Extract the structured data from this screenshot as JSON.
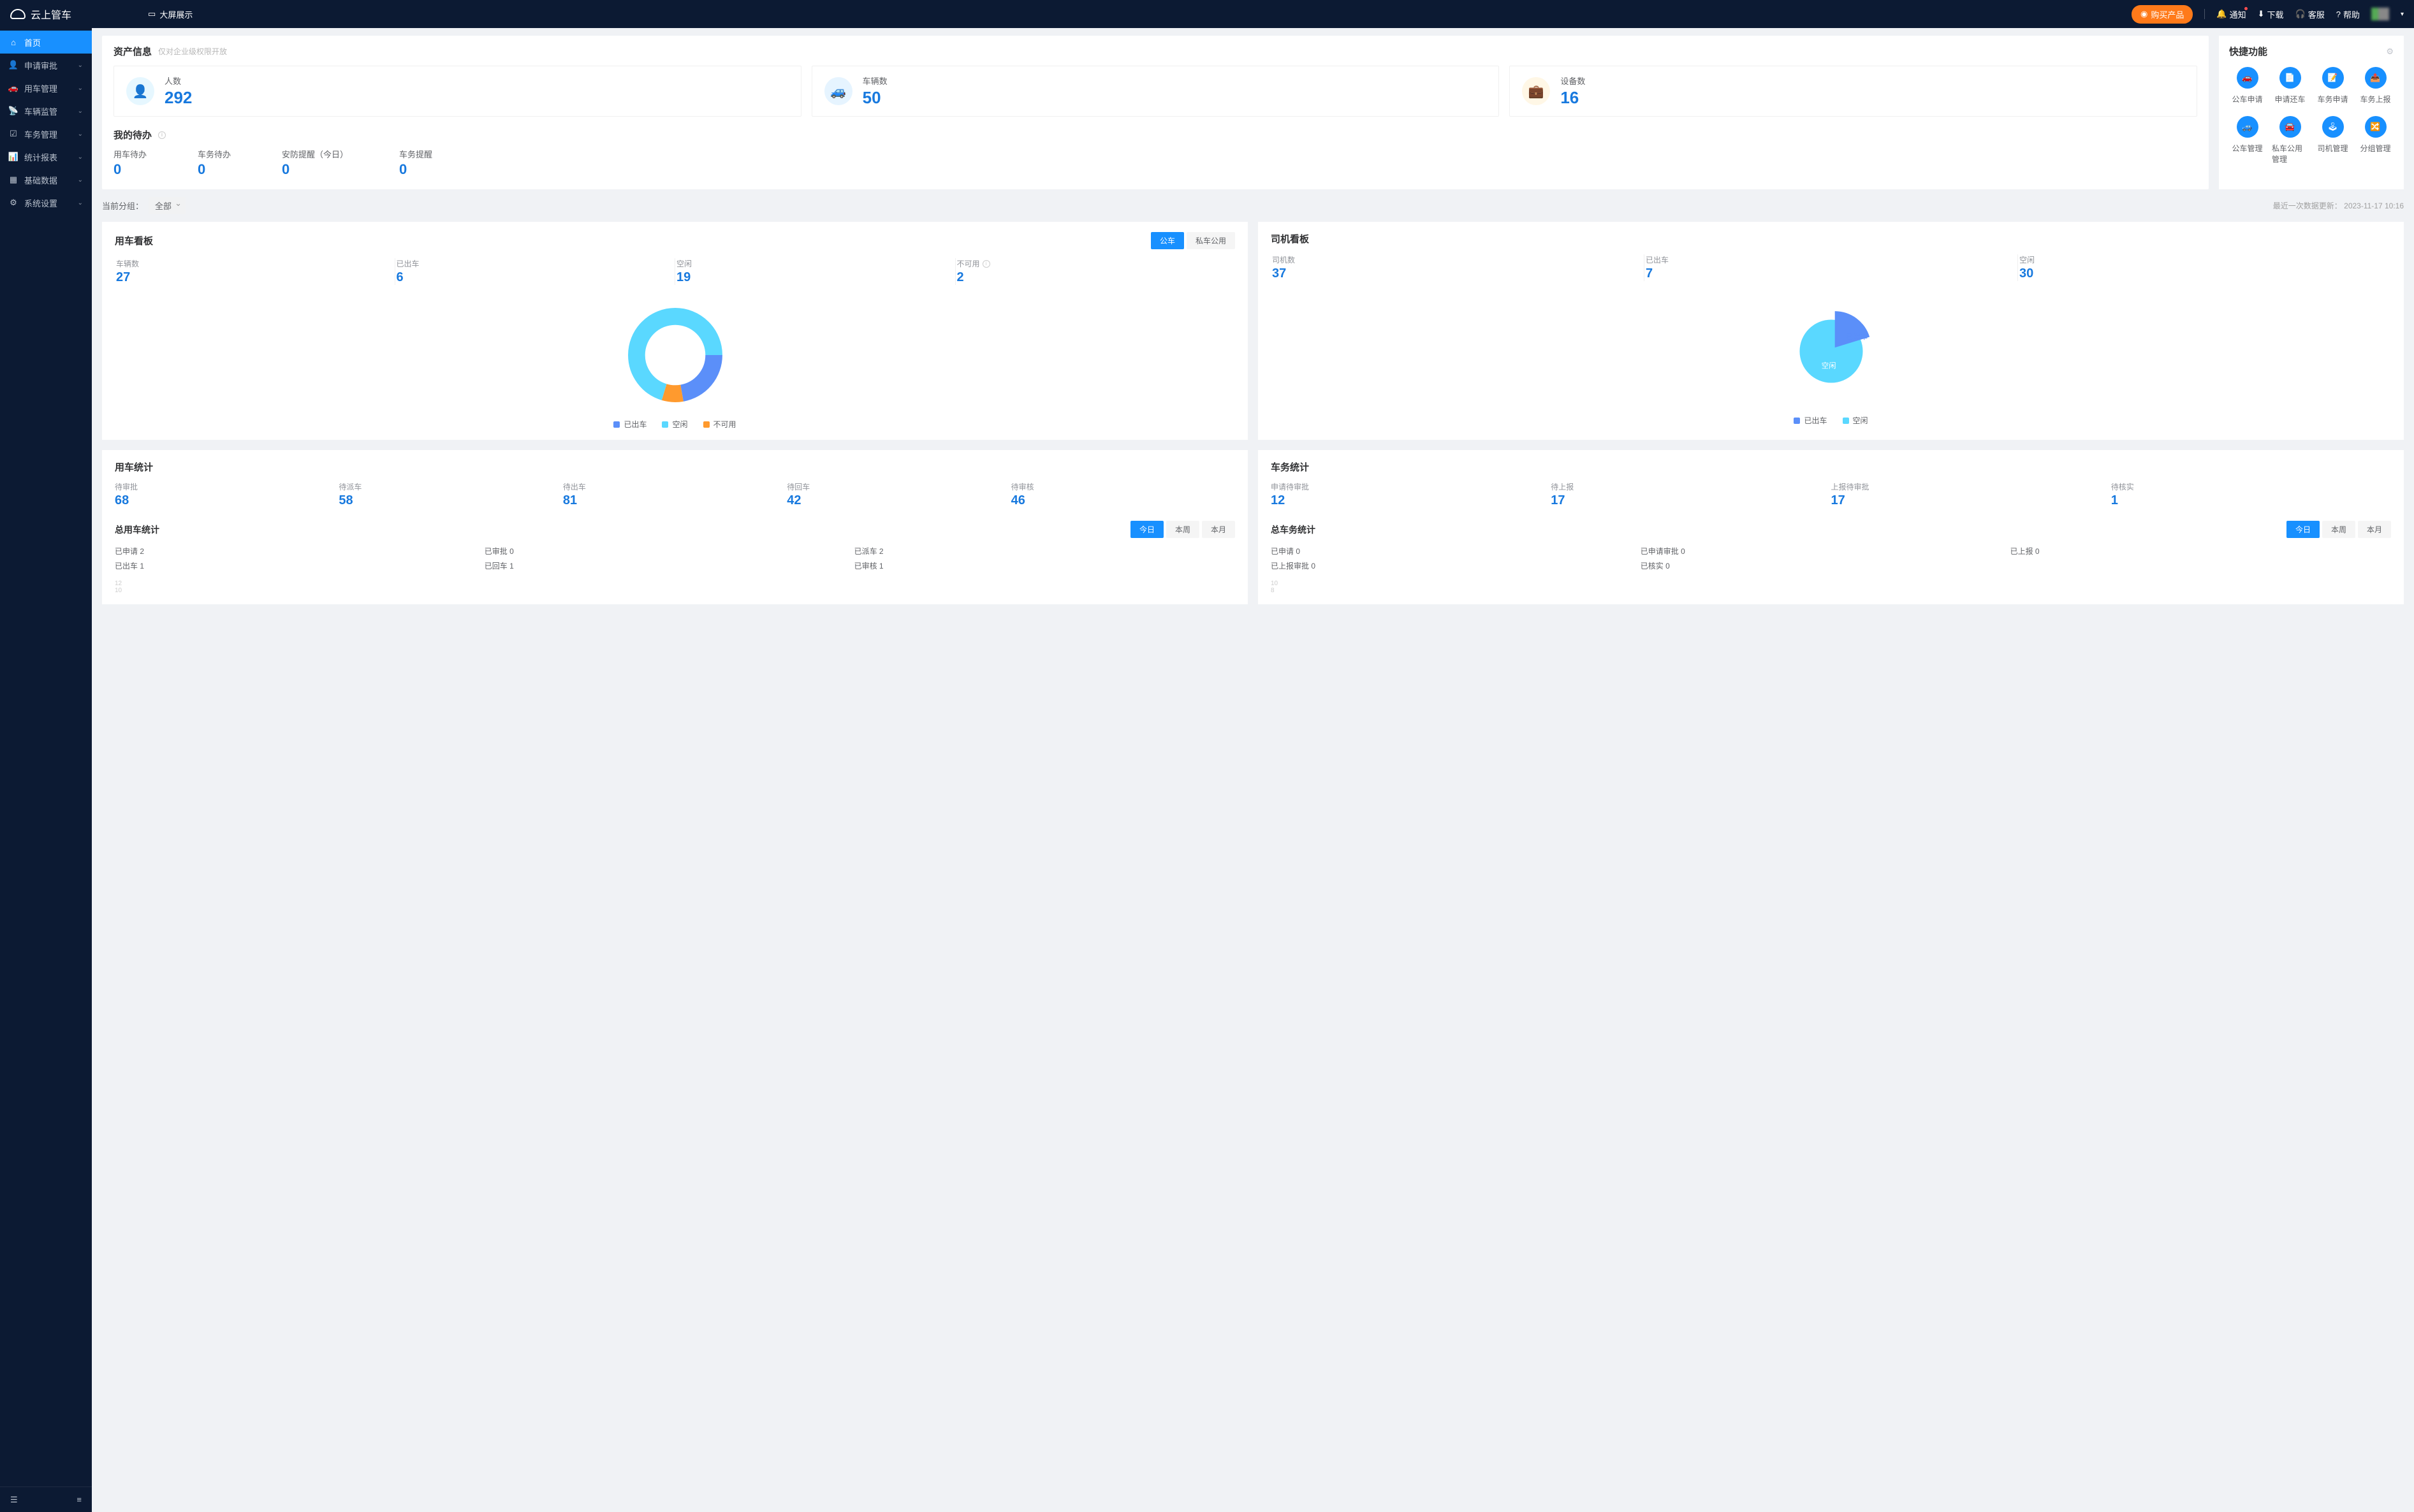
{
  "brand": "云上管车",
  "topbar": {
    "big_screen": "大屏展示",
    "buy": "购买产品",
    "notify": "通知",
    "download": "下载",
    "service": "客服",
    "help": "帮助"
  },
  "sidebar": {
    "items": [
      {
        "label": "首页",
        "active": true
      },
      {
        "label": "申请审批",
        "expandable": true
      },
      {
        "label": "用车管理",
        "expandable": true
      },
      {
        "label": "车辆监管",
        "expandable": true
      },
      {
        "label": "车务管理",
        "expandable": true
      },
      {
        "label": "统计报表",
        "expandable": true
      },
      {
        "label": "基础数据",
        "expandable": true
      },
      {
        "label": "系统设置",
        "expandable": true
      }
    ]
  },
  "assets": {
    "title": "资产信息",
    "note": "仅对企业级权限开放",
    "cards": [
      {
        "label": "人数",
        "value": "292"
      },
      {
        "label": "车辆数",
        "value": "50"
      },
      {
        "label": "设备数",
        "value": "16"
      }
    ]
  },
  "shortcuts": {
    "title": "快捷功能",
    "items": [
      {
        "label": "公车申请"
      },
      {
        "label": "申请还车"
      },
      {
        "label": "车务申请"
      },
      {
        "label": "车务上报"
      },
      {
        "label": "公车管理"
      },
      {
        "label": "私车公用管理"
      },
      {
        "label": "司机管理"
      },
      {
        "label": "分组管理"
      }
    ]
  },
  "todo": {
    "title": "我的待办",
    "items": [
      {
        "label": "用车待办",
        "value": "0"
      },
      {
        "label": "车务待办",
        "value": "0"
      },
      {
        "label": "安防提醒（今日）",
        "value": "0"
      },
      {
        "label": "车务提醒",
        "value": "0"
      }
    ]
  },
  "filter": {
    "label": "当前分组：",
    "value": "全部",
    "update_label": "最近一次数据更新：",
    "update_time": "2023-11-17 10:16"
  },
  "vehicle_board": {
    "title": "用车看板",
    "tabs": [
      {
        "label": "公车",
        "active": true
      },
      {
        "label": "私车公用"
      }
    ],
    "stats": [
      {
        "label": "车辆数",
        "value": "27"
      },
      {
        "label": "已出车",
        "value": "6"
      },
      {
        "label": "空闲",
        "value": "19"
      },
      {
        "label": "不可用",
        "value": "2",
        "info": true
      }
    ],
    "legend": [
      {
        "label": "已出车",
        "color": "#5b8ff9"
      },
      {
        "label": "空闲",
        "color": "#5ad8ff"
      },
      {
        "label": "不可用",
        "color": "#ff9a2e"
      }
    ]
  },
  "driver_board": {
    "title": "司机看板",
    "stats": [
      {
        "label": "司机数",
        "value": "37"
      },
      {
        "label": "已出车",
        "value": "7"
      },
      {
        "label": "空闲",
        "value": "30"
      }
    ],
    "labels": {
      "busy": "已出车",
      "idle": "空闲"
    },
    "legend": [
      {
        "label": "已出车",
        "color": "#5b8ff9"
      },
      {
        "label": "空闲",
        "color": "#5ad8ff"
      }
    ]
  },
  "usage_stats": {
    "title": "用车统计",
    "nums": [
      {
        "label": "待审批",
        "value": "68"
      },
      {
        "label": "待派车",
        "value": "58"
      },
      {
        "label": "待出车",
        "value": "81"
      },
      {
        "label": "待回车",
        "value": "42"
      },
      {
        "label": "待审核",
        "value": "46"
      }
    ],
    "total_title": "总用车统计",
    "tabs": [
      {
        "label": "今日",
        "active": true
      },
      {
        "label": "本周"
      },
      {
        "label": "本月"
      }
    ],
    "mini": [
      {
        "text": "已申请  2"
      },
      {
        "text": "已审批  0"
      },
      {
        "text": "已派车  2"
      },
      {
        "text": "已出车  1"
      },
      {
        "text": "已回车  1"
      },
      {
        "text": "已审核  1"
      }
    ],
    "ticks": [
      "12",
      "10"
    ]
  },
  "service_stats": {
    "title": "车务统计",
    "nums": [
      {
        "label": "申请待审批",
        "value": "12"
      },
      {
        "label": "待上报",
        "value": "17"
      },
      {
        "label": "上报待审批",
        "value": "17"
      },
      {
        "label": "待核实",
        "value": "1"
      }
    ],
    "total_title": "总车务统计",
    "tabs": [
      {
        "label": "今日",
        "active": true
      },
      {
        "label": "本周"
      },
      {
        "label": "本月"
      }
    ],
    "mini": [
      {
        "text": "已申请  0"
      },
      {
        "text": "已申请审批  0"
      },
      {
        "text": "已上报  0"
      },
      {
        "text": "已上报审批  0"
      },
      {
        "text": "已核实  0"
      }
    ],
    "ticks": [
      "10",
      "8"
    ]
  },
  "chart_data": [
    {
      "type": "pie",
      "title": "用车看板",
      "series": [
        {
          "name": "已出车",
          "value": 6,
          "color": "#5b8ff9"
        },
        {
          "name": "空闲",
          "value": 19,
          "color": "#5ad8ff"
        },
        {
          "name": "不可用",
          "value": 2,
          "color": "#ff9a2e"
        }
      ],
      "donut": true
    },
    {
      "type": "pie",
      "title": "司机看板",
      "series": [
        {
          "name": "已出车",
          "value": 7,
          "color": "#5b8ff9"
        },
        {
          "name": "空闲",
          "value": 30,
          "color": "#5ad8ff"
        }
      ],
      "donut": false
    }
  ]
}
